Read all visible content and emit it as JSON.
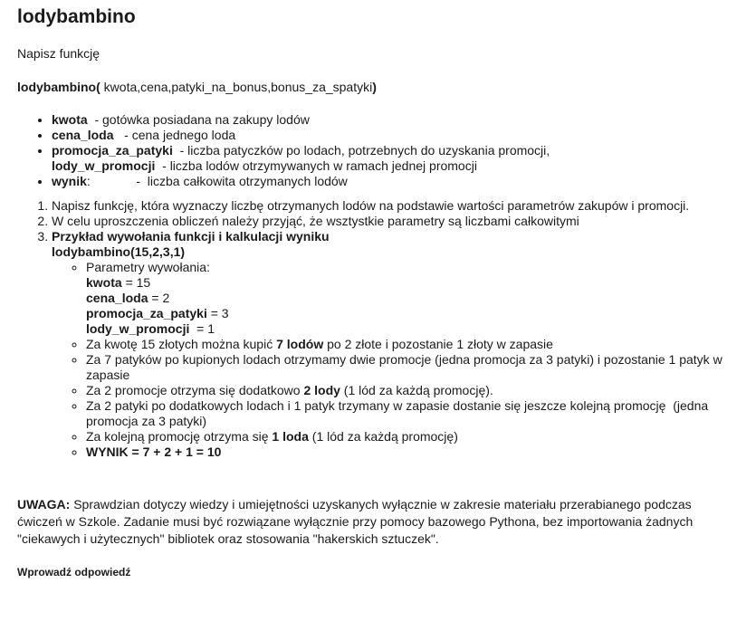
{
  "title": "lodybambino",
  "intro": "Napisz funkcję",
  "signature": {
    "name": "lodybambino(",
    "args": " kwota,cena,patyki_na_bonus,bonus_za_spatyki",
    "close": ")"
  },
  "params": [
    {
      "name": "kwota",
      "desc": "  - gotówka posiadana na zakupy lodów"
    },
    {
      "name": "cena_loda",
      "desc": "   - cena jednego loda"
    },
    {
      "name": "promocja_za_patyki",
      "desc": "  - liczba patyczków po lodach, potrzebnych do uzyskania promocji,",
      "name2": "lody_w_promocji",
      "desc2": "  - liczba lodów otrzymywanych w ramach jednej promocji"
    },
    {
      "name": "wynik",
      "desc": ":             -  liczba całkowita otrzymanych lodów"
    }
  ],
  "tasks": {
    "t1": "Napisz funkcję, która wyznaczy liczbę otrzymanych lodów na podstawie wartości parametrów zakupów i promocji.",
    "t2": "W celu uproszczenia obliczeń należy przyjąć, że wsztystkie parametry są liczbami całkowitymi",
    "t3_heading": "Przykład wywołania funkcji i kalkulacji wyniku",
    "t3_call": "lodybambino(15,2,3,1)"
  },
  "example": {
    "params_label": "Parametry wywołania:",
    "p1_name": "kwota",
    "p1_val": " = 15",
    "p2_name": "cena_loda",
    "p2_val": " = 2",
    "p3_name": "promocja_za_patyki",
    "p3_val": " = 3",
    "p4_name": "lody_w_promocji",
    "p4_val": "  = 1",
    "s1_a": "Za kwotę 15 złotych można kupić ",
    "s1_b": "7 lodów",
    "s1_c": " po 2 złote i pozostanie 1 złoty w zapasie",
    "s2": "Za 7 patyków po kupionych lodach otrzymamy dwie promocje (jedna promocja za 3 patyki) i pozostanie 1 patyk w zapasie",
    "s3_a": "Za 2 promocje otrzyma się dodatkowo ",
    "s3_b": "2 lody",
    "s3_c": " (1 lód za każdą promocję).",
    "s4": "Za 2 patyki po dodatkowych lodach i 1 patyk trzymany w zapasie dostanie się jeszcze kolejną promocję  (jedna promocja za 3 patyki)",
    "s5_a": "Za kolejną promocję otrzyma się ",
    "s5_b": "1 loda",
    "s5_c": " (1 lód za każdą promocję)",
    "result": "WYNIK = 7 + 2 + 1 = 10"
  },
  "warning": {
    "label": "UWAGA:",
    "text": " Sprawdzian dotyczy wiedzy i umiejętności uzyskanych wyłącznie w zakresie materiału przerabianego podczas ćwiczeń w Szkole. Zadanie musi być rozwiązane wyłącznie przy pomocy bazowego Python­a, bez importowania żadnych \"ciekawych i użytecznych\" bibliotek oraz stosowania \"hakerskich sztuczek\"."
  },
  "answer_label": "Wprowadź odpowiedź"
}
